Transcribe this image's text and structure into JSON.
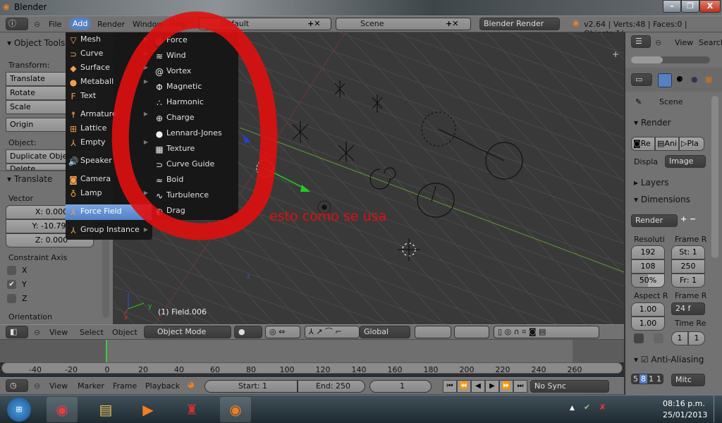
{
  "window": {
    "title": "Blender",
    "minimize": "–",
    "maximize": "❐",
    "close": "X"
  },
  "info_header": {
    "menus": [
      "File",
      "Add",
      "Render",
      "Window",
      "Help"
    ],
    "layout": "Default",
    "scene": "Scene",
    "engine": "Blender Render",
    "stats": "v2.64 | Verts:48 | Faces:0 | Objects:1/"
  },
  "tool_shelf": {
    "title": "Object Tools",
    "transform_label": "Transform:",
    "buttons": [
      "Translate",
      "Rotate",
      "Scale"
    ],
    "origin": "Origin",
    "object_label": "Object:",
    "duplicate": "Duplicate Objec",
    "delete": "Delete"
  },
  "operator_panel": {
    "title": "Translate",
    "vector_label": "Vector",
    "x": "X: 0.000",
    "y": "Y: -10.791",
    "z": "Z: 0.000",
    "constraint_label": "Constraint Axis",
    "axes": [
      {
        "label": "X",
        "checked": false
      },
      {
        "label": "Y",
        "checked": true
      },
      {
        "label": "Z",
        "checked": false
      }
    ],
    "orientation": "Orientation"
  },
  "add_menu": {
    "items": [
      {
        "label": "Mesh",
        "icon": "▽",
        "sub": true
      },
      {
        "label": "Curve",
        "icon": "⊃",
        "sub": true
      },
      {
        "label": "Surface",
        "icon": "◆",
        "sub": true
      },
      {
        "label": "Metaball",
        "icon": "●",
        "sub": true
      },
      {
        "label": "Text",
        "icon": "F",
        "sub": false
      },
      {
        "label": "Armature",
        "icon": "☨",
        "sub": true
      },
      {
        "label": "Lattice",
        "icon": "⊞",
        "sub": false
      },
      {
        "label": "Empty",
        "icon": "⅄",
        "sub": true
      },
      {
        "label": "Speaker",
        "icon": "🔊",
        "sub": false
      },
      {
        "label": "Camera",
        "icon": "◙",
        "sub": false
      },
      {
        "label": "Lamp",
        "icon": "♁",
        "sub": true
      },
      {
        "label": "Force Field",
        "icon": "⅄",
        "sub": true,
        "selected": true
      },
      {
        "label": "Group Instance",
        "icon": "⅄",
        "sub": true
      }
    ]
  },
  "force_field_menu": {
    "items": [
      {
        "label": "Force",
        "icon": "◎"
      },
      {
        "label": "Wind",
        "icon": "≋"
      },
      {
        "label": "Vortex",
        "icon": "@"
      },
      {
        "label": "Magnetic",
        "icon": "Φ"
      },
      {
        "label": "Harmonic",
        "icon": "∴"
      },
      {
        "label": "Charge",
        "icon": "⊕"
      },
      {
        "label": "Lennard-Jones",
        "icon": "●"
      },
      {
        "label": "Texture",
        "icon": "▦"
      },
      {
        "label": "Curve Guide",
        "icon": "⊃"
      },
      {
        "label": "Boid",
        "icon": "≈"
      },
      {
        "label": "Turbulence",
        "icon": "∿"
      },
      {
        "label": "Drag",
        "icon": "◐"
      }
    ]
  },
  "viewport": {
    "object_label": "(1) Field.006",
    "annotation": "esto como se usa",
    "axis_x": "x",
    "axis_y": "y",
    "axis_z": "z"
  },
  "view3d_header": {
    "menus": [
      "View",
      "Select",
      "Object"
    ],
    "mode": "Object Mode",
    "orientation": "Global"
  },
  "timeline": {
    "ticks": [
      -40,
      -20,
      0,
      20,
      40,
      60,
      80,
      100,
      120,
      140,
      160,
      180,
      200,
      220,
      240,
      260
    ],
    "current_frame": 1,
    "menus": [
      "View",
      "Marker",
      "Frame",
      "Playback"
    ],
    "start": "Start: 1",
    "end": "End: 250",
    "frame": "1",
    "sync": "No Sync",
    "playback": [
      "⏮",
      "⏪",
      "◀",
      "▶",
      "⏩",
      "⏭"
    ]
  },
  "outliner": {
    "menus": [
      "View",
      "Search"
    ]
  },
  "properties": {
    "scene": "Scene",
    "render_panel": "Render",
    "render_btns": [
      "Re",
      "Ani",
      "Pla"
    ],
    "display_label": "Displa",
    "display_value": "Image",
    "layers_panel": "Layers",
    "dimensions_panel": "Dimensions",
    "preset": "Render",
    "resolution_label": "Resoluti",
    "res_x": "192",
    "res_y": "108",
    "res_pct": "50%",
    "res_pct_value": 50,
    "frame_range_label": "Frame R",
    "frame_start": "St: 1",
    "frame_end": "250",
    "frame_step": "Fr: 1",
    "aspect_label": "Aspect R",
    "aspect_x": "1.00",
    "aspect_y": "1.00",
    "fps_label": "Frame R",
    "fps": "24 f",
    "time_remap_label": "Time Re",
    "time_old": "1",
    "time_new": "1",
    "aa_panel": "Anti-Aliasing",
    "aa_samples": [
      "5",
      "8",
      "1",
      "1"
    ],
    "aa_filter": "Mitc"
  },
  "taskbar": {
    "time": "08:16 p.m.",
    "date": "25/01/2013"
  },
  "colors": {
    "annotation": "#e01010",
    "accent": "#5680c2",
    "playhead": "#3ccc3c"
  }
}
